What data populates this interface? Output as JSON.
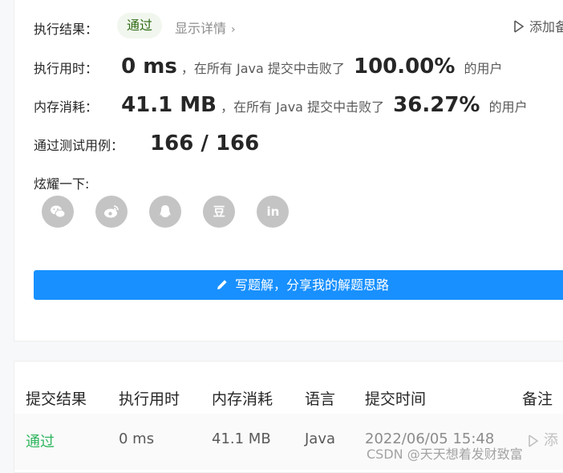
{
  "result": {
    "label": "执行结果：",
    "status": "通过",
    "details_link": "显示详情",
    "details_chevron": "›",
    "add_note": "添加备"
  },
  "runtime": {
    "label": "执行用时：",
    "value": "0 ms",
    "prefix": "，在所有 Java 提交中击败了",
    "percent": "100.00%",
    "suffix": "的用户"
  },
  "memory": {
    "label": "内存消耗：",
    "value": "41.1 MB",
    "prefix": "，在所有 Java 提交中击败了",
    "percent": "36.27%",
    "suffix": "的用户"
  },
  "tests": {
    "label": "通过测试用例：",
    "value": "166 / 166"
  },
  "share": {
    "label": "炫耀一下:",
    "icons": [
      "wechat-icon",
      "weibo-icon",
      "qq-icon",
      "douban-icon",
      "linkedin-icon"
    ],
    "douban_glyph": "豆",
    "linkedin_glyph": "in"
  },
  "write_button": "写题解，分享我的解题思路",
  "table": {
    "headers": [
      "提交结果",
      "执行用时",
      "内存消耗",
      "语言",
      "提交时间",
      "备注"
    ],
    "rows": [
      {
        "status": "通过",
        "runtime": "0 ms",
        "memory": "41.1 MB",
        "language": "Java",
        "time": "2022/06/05 15:48",
        "note": "添"
      }
    ]
  },
  "watermark": "CSDN @天天想着发财致富",
  "colors": {
    "accent": "#1890ff",
    "pass_green": "#2db55d",
    "pill_bg": "#f1f7ee",
    "icon_gray": "#c4c4c4"
  }
}
